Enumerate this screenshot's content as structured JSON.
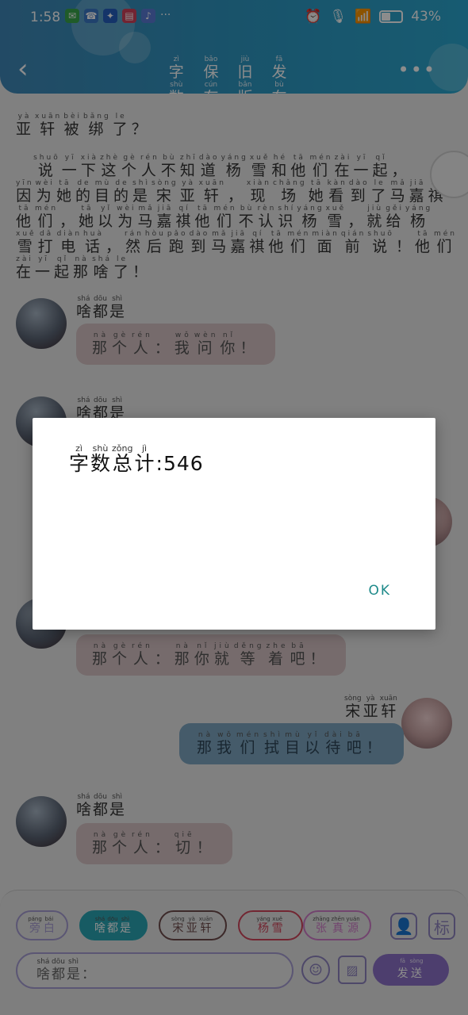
{
  "status_bar": {
    "time": "1:58",
    "battery": "43%",
    "battery_level": 0.43,
    "more": "···"
  },
  "header": {
    "back_icon": "chevron-left-icon",
    "actions": [
      {
        "chars": [
          [
            "zì",
            "字"
          ],
          [
            "shù",
            "数"
          ],
          [
            "tǒng",
            "统"
          ],
          [
            "jì",
            "计"
          ]
        ]
      },
      {
        "chars": [
          [
            "bǎo",
            "保"
          ],
          [
            "cún",
            "存"
          ]
        ]
      },
      {
        "chars": [
          [
            "jiù",
            "旧"
          ],
          [
            "bǎn",
            "版"
          ]
        ]
      },
      {
        "chars": [
          [
            "fā",
            "发"
          ],
          [
            "bù",
            "布"
          ]
        ]
      }
    ],
    "more_icon": "•••"
  },
  "narration": {
    "line1": [
      [
        "yà",
        "亚"
      ],
      [
        "xuān",
        "轩"
      ],
      [
        "bèi",
        "被"
      ],
      [
        "bǎng",
        "绑"
      ],
      [
        "le",
        "了"
      ],
      [
        "",
        "？"
      ]
    ],
    "paragraph": [
      [
        [
          "",
          ""
        ],
        [
          "",
          ""
        ],
        [
          "shuō",
          "说"
        ],
        [
          "yī",
          "一"
        ],
        [
          "xià",
          "下"
        ],
        [
          "zhè",
          "这"
        ],
        [
          "gè",
          "个"
        ],
        [
          "rén",
          "人"
        ],
        [
          "bù",
          "不"
        ],
        [
          "zhī",
          "知"
        ],
        [
          "dào",
          "道"
        ],
        [
          "yáng",
          "杨"
        ],
        [
          "xuě",
          "雪"
        ],
        [
          "hé",
          "和"
        ],
        [
          "tā",
          "他"
        ],
        [
          "mén",
          "们"
        ],
        [
          "zài",
          "在"
        ],
        [
          "yī",
          "一"
        ],
        [
          "qǐ",
          "起"
        ],
        [
          "",
          "，"
        ]
      ],
      [
        [
          "yīn",
          "因"
        ],
        [
          "wèi",
          "为"
        ],
        [
          "tā",
          "她"
        ],
        [
          "de",
          "的"
        ],
        [
          "mù",
          "目"
        ],
        [
          "de",
          "的"
        ],
        [
          "shì",
          "是"
        ],
        [
          "sòng",
          "宋"
        ],
        [
          "yà",
          "亚"
        ],
        [
          "xuān",
          "轩"
        ],
        [
          "",
          "，"
        ],
        [
          "xiàn",
          "现"
        ],
        [
          "chǎng",
          "场"
        ],
        [
          "tā",
          "她"
        ],
        [
          "kàn",
          "看"
        ],
        [
          "dào",
          "到"
        ],
        [
          "le",
          "了"
        ],
        [
          "mǎ",
          "马"
        ],
        [
          "jiā",
          "嘉"
        ],
        [
          "qí",
          "祺"
        ]
      ],
      [
        [
          "tā",
          "他"
        ],
        [
          "mén",
          "们"
        ],
        [
          "",
          "，"
        ],
        [
          "tā",
          "她"
        ],
        [
          "yǐ",
          "以"
        ],
        [
          "wèi",
          "为"
        ],
        [
          "mǎ",
          "马"
        ],
        [
          "jiā",
          "嘉"
        ],
        [
          "qí",
          "祺"
        ],
        [
          "tā",
          "他"
        ],
        [
          "mén",
          "们"
        ],
        [
          "bù",
          "不"
        ],
        [
          "rèn",
          "认"
        ],
        [
          "shí",
          "识"
        ],
        [
          "yáng",
          "杨"
        ],
        [
          "xuě",
          "雪"
        ],
        [
          "",
          "，"
        ],
        [
          "jiù",
          "就"
        ],
        [
          "gěi",
          "给"
        ],
        [
          "yáng",
          "杨"
        ]
      ],
      [
        [
          "xuě",
          "雪"
        ],
        [
          "dǎ",
          "打"
        ],
        [
          "diàn",
          "电"
        ],
        [
          "huà",
          "话"
        ],
        [
          "",
          "，"
        ],
        [
          "rán",
          "然"
        ],
        [
          "hòu",
          "后"
        ],
        [
          "pǎo",
          "跑"
        ],
        [
          "dào",
          "到"
        ],
        [
          "mǎ",
          "马"
        ],
        [
          "jiā",
          "嘉"
        ],
        [
          "qí",
          "祺"
        ],
        [
          "tā",
          "他"
        ],
        [
          "mén",
          "们"
        ],
        [
          "miàn",
          "面"
        ],
        [
          "qián",
          "前"
        ],
        [
          "shuō",
          "说"
        ],
        [
          "",
          "！"
        ],
        [
          "tā",
          "他"
        ],
        [
          "mén",
          "们"
        ]
      ],
      [
        [
          "zài",
          "在"
        ],
        [
          "yī",
          "一"
        ],
        [
          "qǐ",
          "起"
        ],
        [
          "nà",
          "那"
        ],
        [
          "shá",
          "啥"
        ],
        [
          "le",
          "了"
        ],
        [
          "",
          "！"
        ]
      ]
    ]
  },
  "messages": [
    {
      "speaker": [
        [
          "shá",
          "啥"
        ],
        [
          "dōu",
          "都"
        ],
        [
          "shì",
          "是"
        ]
      ],
      "text": [
        [
          "nà",
          "那"
        ],
        [
          "gè",
          "个"
        ],
        [
          "rén",
          "人"
        ],
        [
          "",
          "："
        ],
        [
          "wǒ",
          "我"
        ],
        [
          "wèn",
          "问"
        ],
        [
          "nǐ",
          "你"
        ],
        [
          "",
          "！"
        ]
      ]
    },
    {
      "speaker": [
        [
          "shá",
          "啥"
        ],
        [
          "dōu",
          "都"
        ],
        [
          "shì",
          "是"
        ]
      ]
    },
    {
      "text": [
        [
          "nà",
          "那"
        ],
        [
          "gè",
          "个"
        ],
        [
          "rén",
          "人"
        ],
        [
          "",
          "："
        ],
        [
          "nà",
          "那"
        ],
        [
          "nǐ",
          "你"
        ],
        [
          "jiù",
          "就"
        ],
        [
          "děng",
          "等"
        ],
        [
          "zhe",
          "着"
        ],
        [
          "bā",
          "吧"
        ],
        [
          "",
          "！"
        ]
      ]
    },
    {
      "speaker": [
        [
          "sòng",
          "宋"
        ],
        [
          "yà",
          "亚"
        ],
        [
          "xuān",
          "轩"
        ]
      ],
      "text": [
        [
          "nà",
          "那"
        ],
        [
          "wǒ",
          "我"
        ],
        [
          "mén",
          "们"
        ],
        [
          "shì",
          "拭"
        ],
        [
          "mù",
          "目"
        ],
        [
          "yǐ",
          "以"
        ],
        [
          "dài",
          "待"
        ],
        [
          "bā",
          "吧"
        ],
        [
          "",
          "！"
        ]
      ]
    },
    {
      "speaker": [
        [
          "shá",
          "啥"
        ],
        [
          "dōu",
          "都"
        ],
        [
          "shì",
          "是"
        ]
      ],
      "text": [
        [
          "nà",
          "那"
        ],
        [
          "gè",
          "个"
        ],
        [
          "rén",
          "人"
        ],
        [
          "",
          "："
        ],
        [
          "qiē",
          "切"
        ],
        [
          "",
          "！"
        ]
      ]
    }
  ],
  "bottom": {
    "roles": [
      {
        "chars": [
          [
            "páng",
            "旁"
          ],
          [
            "bái",
            "白"
          ]
        ],
        "color": "#a79dd3"
      },
      {
        "chars": [
          [
            "shá",
            "啥"
          ],
          [
            "dōu",
            "都"
          ],
          [
            "shì",
            "是"
          ]
        ],
        "color": "#2aa7b5",
        "active": true
      },
      {
        "chars": [
          [
            "sòng",
            "宋"
          ],
          [
            "yà",
            "亚"
          ],
          [
            "xuān",
            "轩"
          ]
        ],
        "color": "#6d4b4b"
      },
      {
        "chars": [
          [
            "yáng",
            "杨"
          ],
          [
            "xuě",
            "雪"
          ]
        ],
        "color": "#d0465b"
      },
      {
        "chars": [
          [
            "zhāng",
            "张"
          ],
          [
            "zhēn",
            "真"
          ],
          [
            "yuán",
            "源"
          ]
        ],
        "color": "#d07cc9"
      }
    ],
    "input_chars": [
      [
        "shá",
        "啥"
      ],
      [
        "dōu",
        "都"
      ],
      [
        "shì",
        "是"
      ],
      [
        "",
        "："
      ]
    ],
    "send_chars": [
      [
        "fā",
        "发"
      ],
      [
        "sòng",
        "送"
      ]
    ],
    "tag_label": "标",
    "emoji_icon": "smile-icon",
    "image_icon": "image-icon",
    "person_icon": "person-icon"
  },
  "dialog": {
    "title_chars": [
      [
        "zì",
        "字"
      ],
      [
        "shù",
        "数"
      ],
      [
        "zǒng",
        "总"
      ],
      [
        "jì",
        "计"
      ]
    ],
    "count_text": ":546",
    "ok_label": "OK"
  }
}
